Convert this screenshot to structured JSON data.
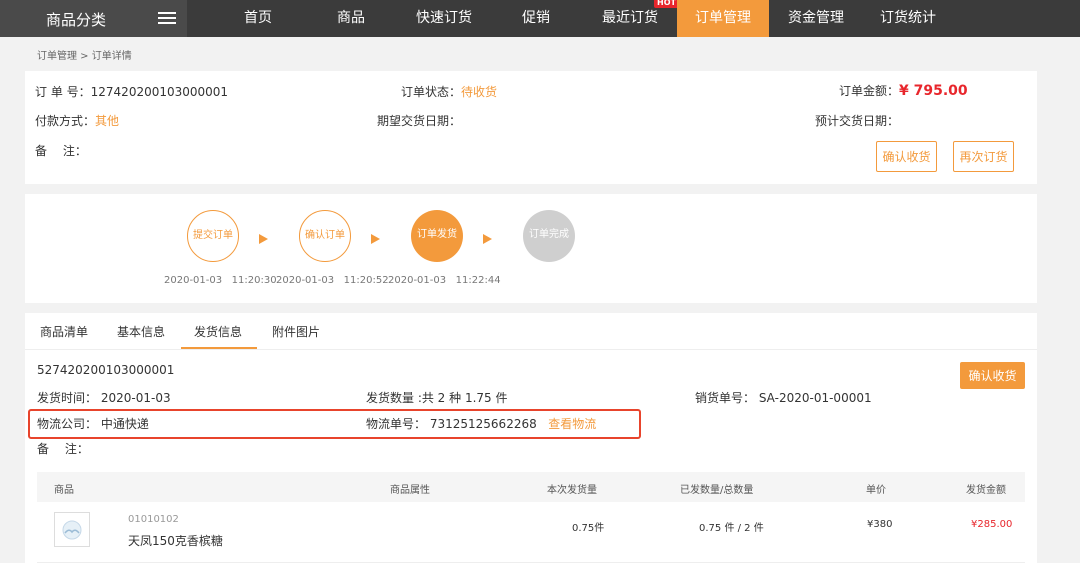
{
  "nav": {
    "category": "商品分类",
    "items": [
      "首页",
      "商品",
      "快速订货",
      "促销",
      "最近订货",
      "订单管理",
      "资金管理",
      "订货统计"
    ],
    "hot_badge": "HOT",
    "accent": "#f39a3c"
  },
  "breadcrumb": "订单管理 > 订单详情",
  "order": {
    "no_label": "订 单 号：",
    "no_value": "127420200103000001",
    "status_label": "订单状态：",
    "status_value": "待收货",
    "amount_label": "订单金额：",
    "amount_value": "¥ 795.00",
    "pay_label": "付款方式：",
    "pay_value": "其他",
    "expect_label": "期望交货日期：",
    "estimate_label": "预计交货日期：",
    "remark_label": "备　 注：",
    "confirm_btn": "确认收货",
    "reorder_btn": "再次订货"
  },
  "progress": {
    "steps": [
      {
        "label": "提交订单",
        "date": "2020-01-03",
        "time": "11:20:30"
      },
      {
        "label": "确认订单",
        "date": "2020-01-03",
        "time": "11:20:52"
      },
      {
        "label": "订单发货",
        "date": "2020-01-03",
        "time": "11:22:44"
      },
      {
        "label": "订单完成"
      }
    ]
  },
  "tabs": [
    "商品清单",
    "基本信息",
    "发货信息",
    "附件图片"
  ],
  "shipment": {
    "no": "527420200103000001",
    "time_label": "发货时间：",
    "time_value": "2020-01-03",
    "qty_label": "发货数量 :",
    "qty_value": "共 2 种 1.75 件",
    "sale_label": "销货单号：",
    "sale_value": "SA-2020-01-00001",
    "company_label": "物流公司：",
    "company_value": "中通快递",
    "track_label": "物流单号：",
    "track_value": "73125125662268",
    "track_link": "查看物流",
    "remark_label": "备　 注：",
    "confirm_btn": "确认收货"
  },
  "table": {
    "headers": [
      "商品",
      "商品属性",
      "本次发货量",
      "已发数量/总数量",
      "单价",
      "发货金额"
    ],
    "rows": [
      {
        "code": "01010102",
        "name": "天凤150克香槟糖",
        "attr": "",
        "qty": "0.75件",
        "sent": "0.75 件 / 2 件",
        "price": "¥380",
        "amount": "¥285.00"
      }
    ]
  }
}
